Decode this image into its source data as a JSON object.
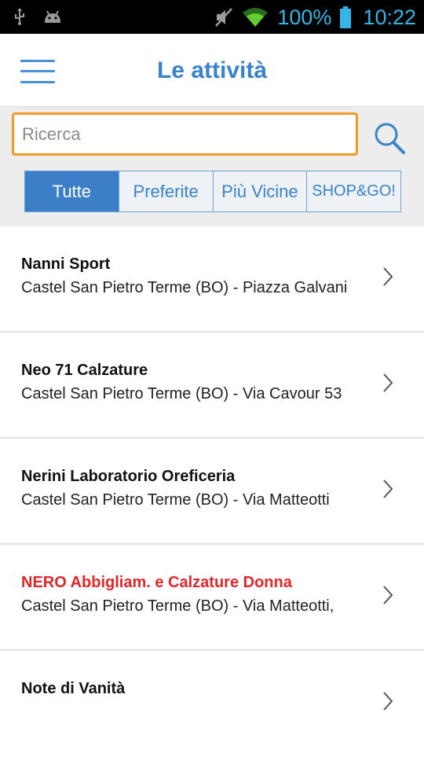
{
  "status_bar": {
    "left_icons": [
      "usb-icon",
      "android-icon"
    ],
    "right_icons": [
      "mute-icon",
      "wifi-icon",
      "battery-icon"
    ],
    "battery": "100%",
    "time": "10:22",
    "accent_color": "#33b5e5"
  },
  "app_bar": {
    "title": "Le attività",
    "menu_icon": "hamburger-menu-icon"
  },
  "search": {
    "placeholder": "Ricerca",
    "value": "",
    "icon": "search-icon",
    "border_color": "#f39a26"
  },
  "tabs": [
    {
      "label": "Tutte",
      "active": true
    },
    {
      "label": "Preferite",
      "active": false
    },
    {
      "label": "Più Vicine",
      "active": false
    },
    {
      "label": "SHOP&GO!",
      "active": false
    }
  ],
  "list": [
    {
      "title": "Nanni Sport",
      "address": "Castel San Pietro Terme (BO) - Piazza Galvani",
      "highlight": false
    },
    {
      "title": "Neo 71 Calzature",
      "address": "Castel San Pietro Terme (BO) - Via Cavour 53",
      "highlight": false
    },
    {
      "title": "Nerini Laboratorio Oreficeria",
      "address": "Castel San Pietro Terme (BO) - Via Matteotti",
      "highlight": false
    },
    {
      "title": "NERO Abbigliam. e Calzature Donna",
      "address": "Castel San Pietro Terme (BO) - Via Matteotti,",
      "highlight": true
    },
    {
      "title": "Note di Vanità",
      "address": "",
      "highlight": false
    }
  ],
  "colors": {
    "primary": "#3a83c9",
    "tab_active_bg": "#3b7fc8",
    "highlight_text": "#e3262a"
  }
}
